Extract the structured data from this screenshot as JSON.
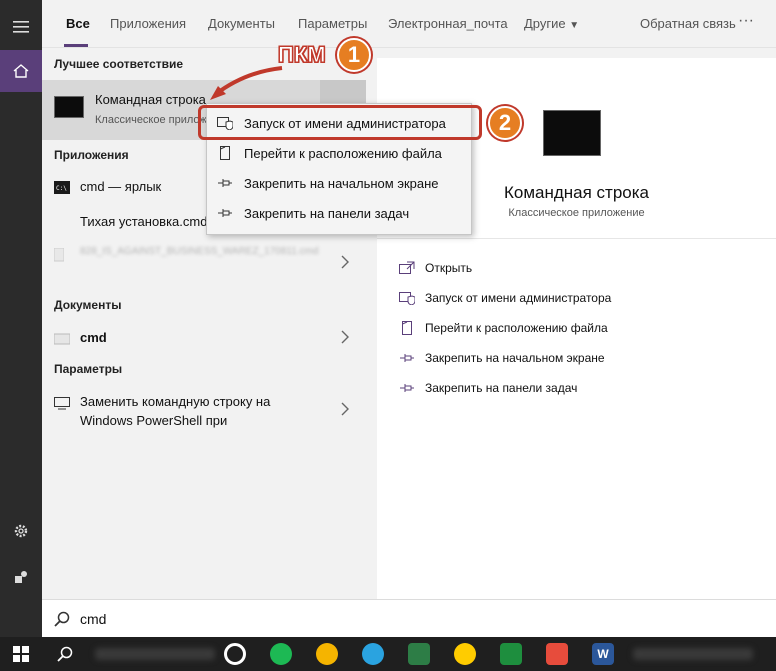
{
  "tabs": {
    "all": "Все",
    "apps": "Приложения",
    "documents": "Документы",
    "settings": "Параметры",
    "email": "Электронная_почта",
    "other": "Другие",
    "feedback": "Обратная связь",
    "more": "···"
  },
  "results": {
    "best_match_title": "Лучшее соответствие",
    "best_match_name": "Командная строка",
    "best_match_type": "Классическое приложение",
    "apps_title": "Приложения",
    "apps": [
      {
        "label": "cmd — ярлык"
      },
      {
        "label": "Тихая установка.cmd"
      },
      {
        "label": "828_IS_AGAINST_BUSINESS_WAREZ_170811.cmd"
      }
    ],
    "documents_title": "Документы",
    "documents": [
      {
        "label": "cmd"
      }
    ],
    "settings_title": "Параметры",
    "settings": [
      {
        "label_line1": "Заменить командную строку на",
        "label_line2": "Windows PowerShell при"
      }
    ]
  },
  "context_menu": {
    "items": [
      {
        "label": "Запуск от имени администратора",
        "icon": "shield-icon"
      },
      {
        "label": "Перейти к расположению файла",
        "icon": "file-location-icon"
      },
      {
        "label": "Закрепить на начальном экране",
        "icon": "pin-icon"
      },
      {
        "label": "Закрепить на панели задач",
        "icon": "pin-icon"
      }
    ]
  },
  "preview": {
    "title": "Командная строка",
    "subtitle": "Классическое приложение",
    "actions": [
      {
        "label": "Открыть",
        "icon": "open-icon"
      },
      {
        "label": "Запуск от имени администратора",
        "icon": "shield-icon"
      },
      {
        "label": "Перейти к расположению файла",
        "icon": "file-location-icon"
      },
      {
        "label": "Закрепить на начальном экране",
        "icon": "pin-icon"
      },
      {
        "label": "Закрепить на панели задач",
        "icon": "pin-icon"
      }
    ]
  },
  "search": {
    "value": "cmd"
  },
  "annotations": {
    "pkm": "ПКМ",
    "step1": "1",
    "step2": "2"
  },
  "taskbar": {
    "word_letter": "W"
  },
  "colors": {
    "accent": "#5a3f7a",
    "highlight": "#c0392b",
    "badge": "#e67e22"
  }
}
